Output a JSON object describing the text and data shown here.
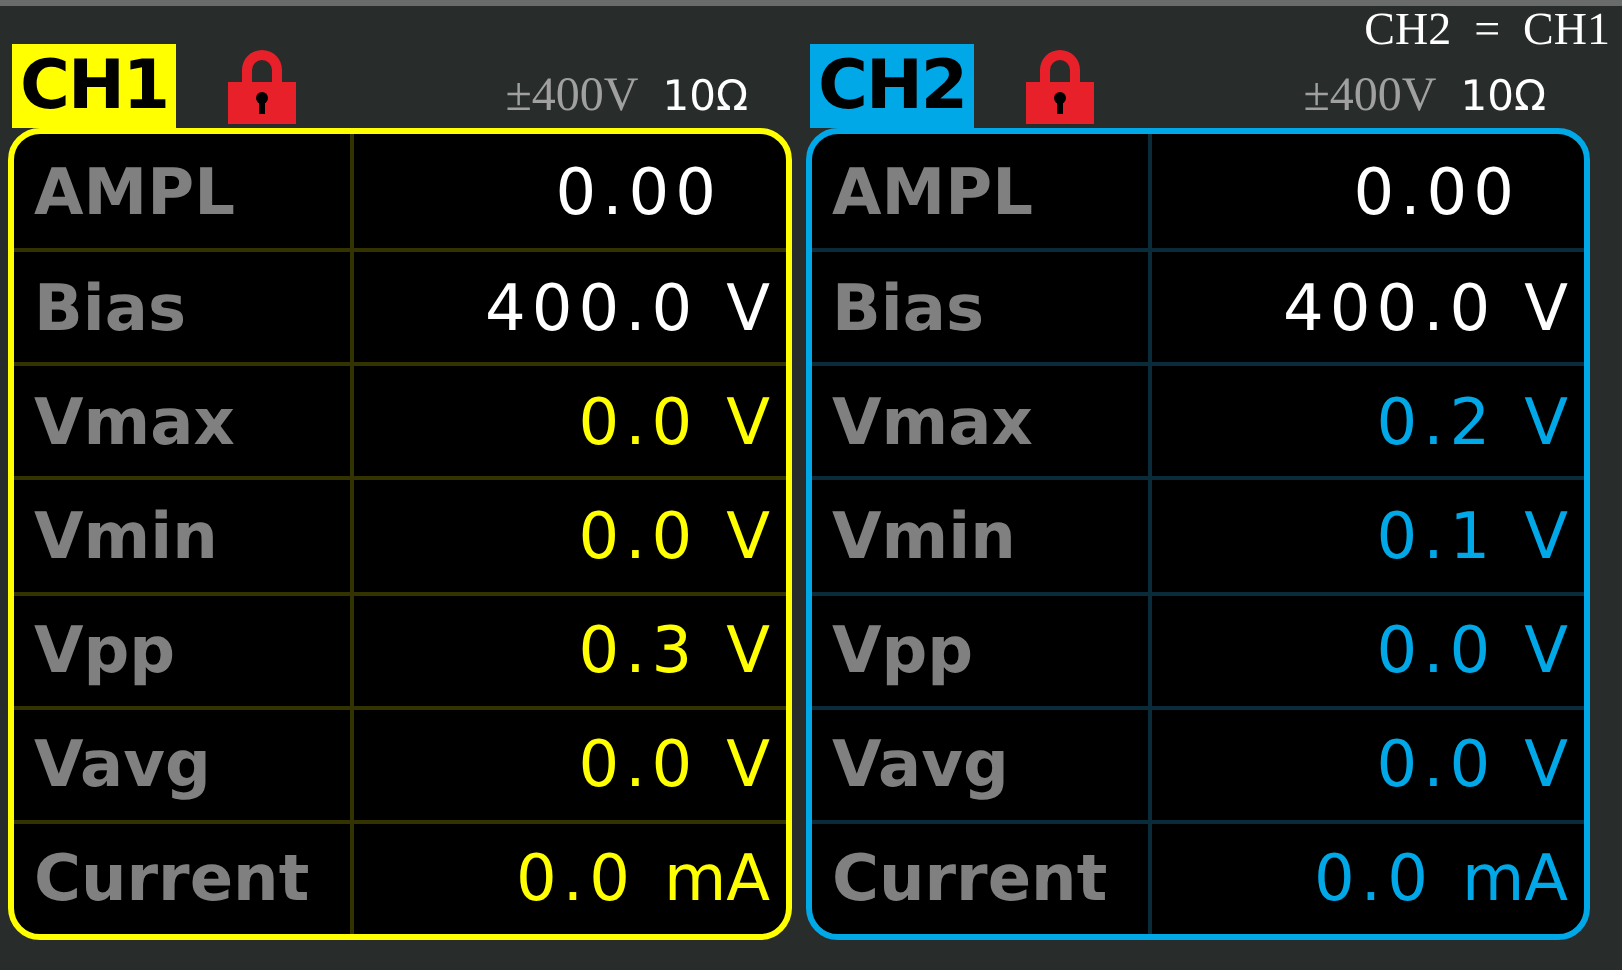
{
  "channels": [
    {
      "name": "CH1",
      "color": "#ffff00",
      "locked": true,
      "range": "±400V",
      "impedance": "10Ω",
      "rows": [
        {
          "label": "AMPL",
          "kind": "setting",
          "value": "0.00"
        },
        {
          "label": "Bias",
          "kind": "setting",
          "value": "400.0",
          "unit": "V"
        },
        {
          "label": "Vmax",
          "kind": "measure",
          "value": "0.0",
          "unit": "V"
        },
        {
          "label": "Vmin",
          "kind": "measure",
          "value": "0.0",
          "unit": "V"
        },
        {
          "label": "Vpp",
          "kind": "measure",
          "value": "0.3",
          "unit": "V"
        },
        {
          "label": "Vavg",
          "kind": "measure",
          "value": "0.0",
          "unit": "V"
        },
        {
          "label": "Current",
          "kind": "measure",
          "value": "0.0",
          "unit": "mA"
        }
      ]
    },
    {
      "name": "CH2",
      "color": "#00a8e8",
      "locked": true,
      "note": "CH2  =  CH1",
      "range": "±400V",
      "impedance": "10Ω",
      "rows": [
        {
          "label": "AMPL",
          "kind": "setting",
          "value": "0.00"
        },
        {
          "label": "Bias",
          "kind": "setting",
          "value": "400.0",
          "unit": "V"
        },
        {
          "label": "Vmax",
          "kind": "measure",
          "value": "0.2",
          "unit": "V"
        },
        {
          "label": "Vmin",
          "kind": "measure",
          "value": "0.1",
          "unit": "V"
        },
        {
          "label": "Vpp",
          "kind": "measure",
          "value": "0.0",
          "unit": "V"
        },
        {
          "label": "Vavg",
          "kind": "measure",
          "value": "0.0",
          "unit": "V"
        },
        {
          "label": "Current",
          "kind": "measure",
          "value": "0.0",
          "unit": "mA"
        }
      ]
    }
  ]
}
